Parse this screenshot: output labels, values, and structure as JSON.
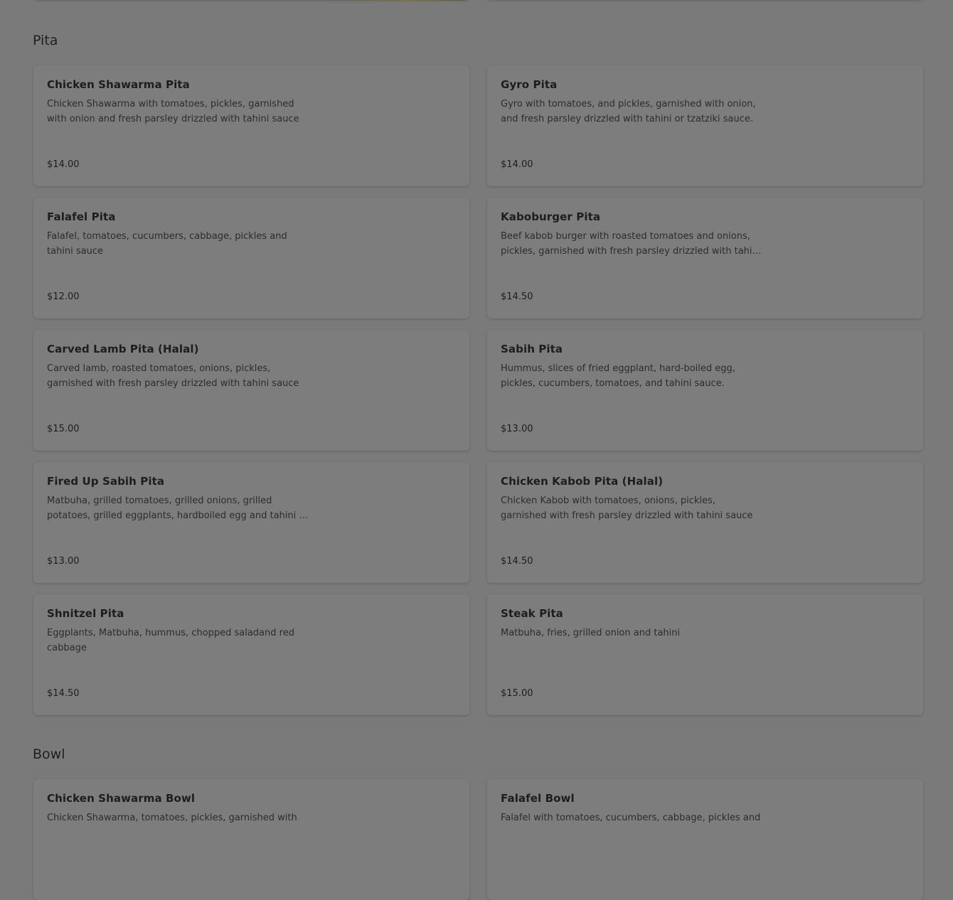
{
  "sections": [
    {
      "title": "Pita",
      "items": [
        {
          "name": "Chicken Shawarma Pita",
          "description": "Chicken Shawarma with tomatoes, pickles, garnished with onion and fresh parsley drizzled with tahini sauce",
          "price": "$14.00"
        },
        {
          "name": "Gyro Pita",
          "description": "Gyro with tomatoes, and pickles, garnished with onion, and fresh parsley drizzled with tahini or tzatziki sauce.",
          "price": "$14.00"
        },
        {
          "name": "Falafel Pita",
          "description": "Falafel, tomatoes, cucumbers, cabbage, pickles and tahini sauce",
          "price": "$12.00"
        },
        {
          "name": "Kaboburger Pita",
          "description": "Beef kabob burger with roasted tomatoes and onions, pickles, garnished with fresh parsley drizzled with tahi…",
          "price": "$14.50"
        },
        {
          "name": "Carved Lamb Pita (Halal)",
          "description": "Carved lamb, roasted tomatoes, onions, pickles, garnished with fresh parsley drizzled with tahini sauce",
          "price": "$15.00"
        },
        {
          "name": "Sabih Pita",
          "description": "Hummus, slices of fried eggplant, hard-boiled egg, pickles, cucumbers, tomatoes, and tahini sauce.",
          "price": "$13.00"
        },
        {
          "name": "Fired Up Sabih Pita",
          "description": "Matbuha, grilled tomatoes, grilled onions, grilled potatoes, grilled eggplants, hardboiled egg and tahini …",
          "price": "$13.00"
        },
        {
          "name": "Chicken Kabob Pita (Halal)",
          "description": "Chicken Kabob with tomatoes, onions, pickles, garnished with fresh parsley drizzled with tahini sauce",
          "price": "$14.50"
        },
        {
          "name": "Shnitzel Pita",
          "description": "Eggplants, Matbuha, hummus, chopped saladand red cabbage",
          "price": "$14.50"
        },
        {
          "name": "Steak Pita",
          "description": "Matbuha, fries, grilled onion and tahini",
          "price": "$15.00"
        }
      ]
    },
    {
      "title": "Bowl",
      "items": [
        {
          "name": "Chicken Shawarma Bowl",
          "description": "Chicken Shawarma, tomatoes, pickles, garnished with",
          "price": ""
        },
        {
          "name": "Falafel Bowl",
          "description": "Falafel with tomatoes, cucumbers, cabbage, pickles and",
          "price": ""
        }
      ]
    }
  ]
}
